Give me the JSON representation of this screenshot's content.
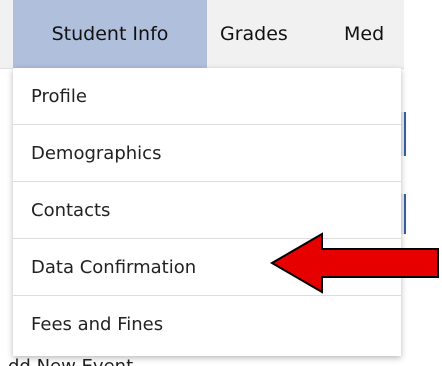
{
  "nav": {
    "tabs": [
      {
        "label": "Student Info"
      },
      {
        "label": "Grades"
      },
      {
        "label": "Med"
      }
    ]
  },
  "dropdown": {
    "items": [
      {
        "label": "Profile"
      },
      {
        "label": "Demographics"
      },
      {
        "label": "Contacts"
      },
      {
        "label": "Data Confirmation"
      },
      {
        "label": "Fees and Fines"
      }
    ]
  },
  "background": {
    "peek_text": "dd New Event"
  },
  "colors": {
    "active_tab": "#afbfdc",
    "arrow_fill": "#e60000",
    "arrow_outline": "#000000"
  }
}
